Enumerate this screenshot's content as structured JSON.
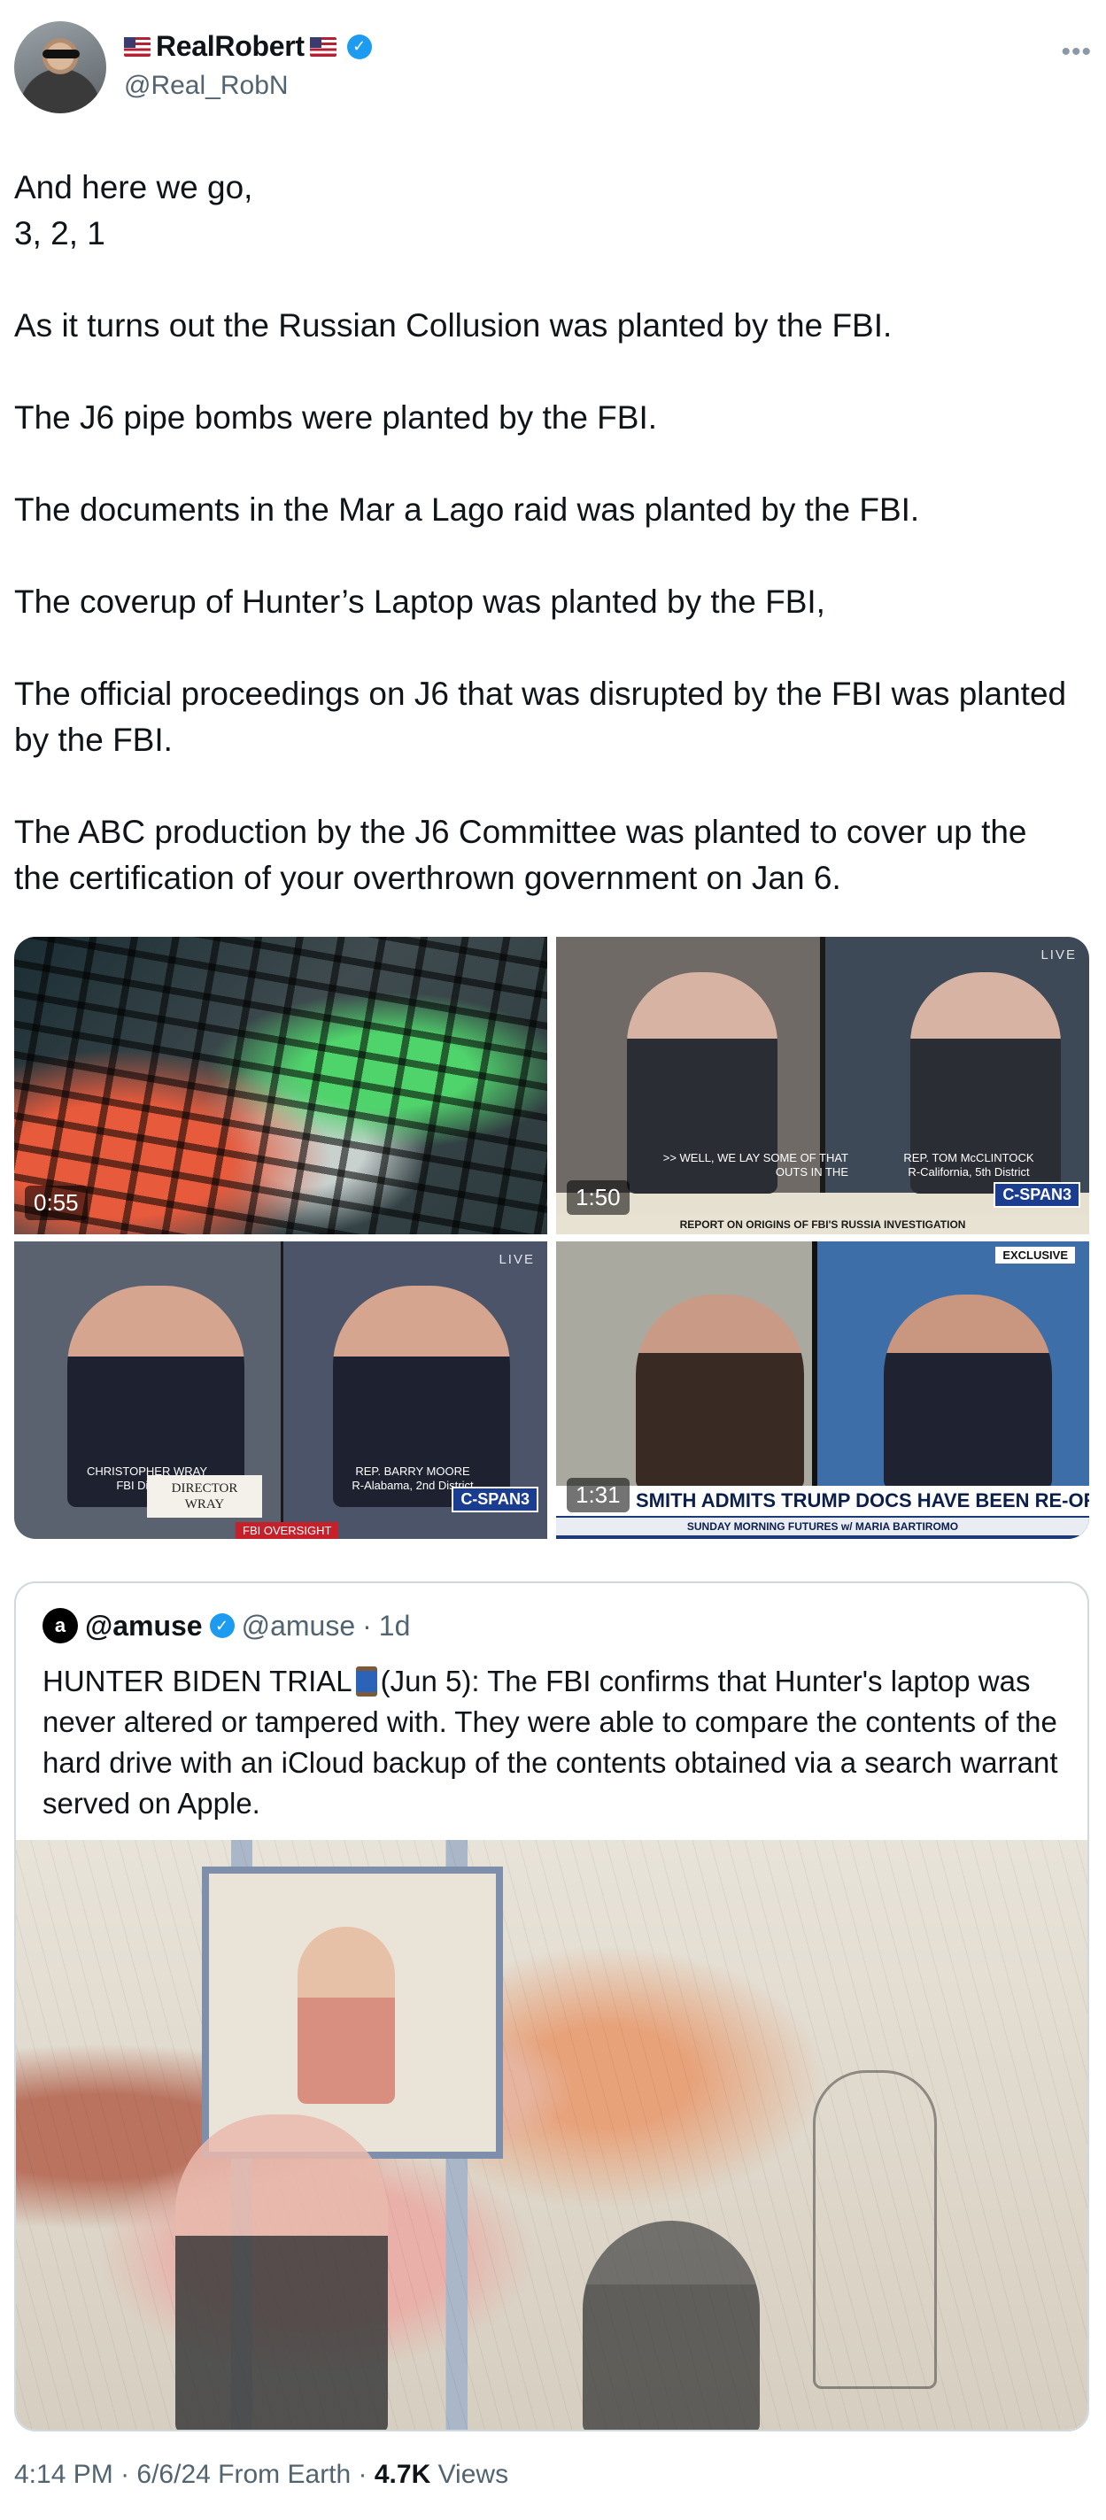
{
  "author": {
    "display_name": "RealRobert",
    "handle": "@Real_RobN"
  },
  "tweet": {
    "text": "And here we go,\n3, 2, 1\n\nAs it turns out the Russian Collusion was planted by the FBI.\n\nThe J6 pipe bombs were planted by the FBI.\n\nThe documents in the Mar a Lago raid was planted by the FBI.\n\nThe coverup of Hunter’s Laptop was planted by the FBI,\n\nThe official proceedings on J6 that was disrupted by the FBI was planted by the FBI.\n\nThe ABC production by the J6 Committee was planted to cover up the the certification of your overthrown government on Jan 6."
  },
  "media": [
    {
      "duration": "0:55"
    },
    {
      "duration": "1:50",
      "live": "LIVE",
      "chyron": ">> WELL, WE LAY SOME OF THAT\nOUTS IN THE",
      "name_right": "REP. TOM McCLINTOCK\nR-California, 5th District",
      "network": "C-SPAN3",
      "banner": "REPORT ON ORIGINS OF FBI'S RUSSIA INVESTIGATION"
    },
    {
      "live": "LIVE",
      "name_left": "CHRISTOPHER WRAY\nFBI Director",
      "name_right": "REP. BARRY MOORE\nR-Alabama, 2nd District",
      "plate": "DIRECTOR\nWRAY",
      "network": "C-SPAN3",
      "tag": "FBI OVERSIGHT"
    },
    {
      "duration": "1:31",
      "exclusive": "EXCLUSIVE",
      "headline": "SMITH ADMITS TRUMP DOCS HAVE BEEN RE-ORDERED",
      "subline": "SUNDAY MORNING FUTURES w/ MARIA BARTIROMO"
    }
  ],
  "quote": {
    "name": "@amuse",
    "handle": "@amuse",
    "time": "1d",
    "text_before": "HUNTER BIDEN TRIAL",
    "text_after": "(Jun 5): The FBI confirms that Hunter's laptop was never altered or tampered with. They were able to compare the contents of the hard drive with an iCloud backup of the contents obtained via a search warrant served on Apple."
  },
  "footer": {
    "time": "4:14 PM",
    "date": "6/6/24",
    "source": "From Earth",
    "views_count": "4.7K",
    "views_label": "Views"
  },
  "colors": {
    "verified": "#1d9bf0",
    "secondary_text": "#536471",
    "border": "#cfd9de"
  }
}
